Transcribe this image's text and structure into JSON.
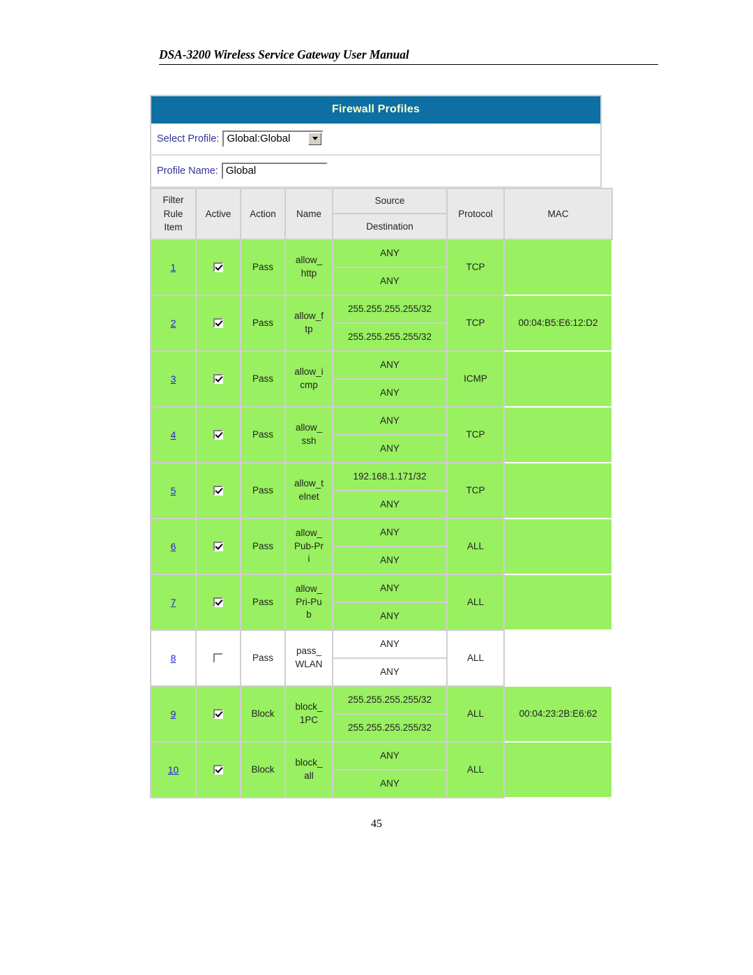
{
  "document": {
    "header_title": "DSA-3200 Wireless Service Gateway User Manual",
    "page_number": "45"
  },
  "panel": {
    "title": "Firewall Profiles",
    "select_profile": {
      "label": "Select Profile:",
      "value": "Global:Global",
      "options": [
        "Global:Global"
      ]
    },
    "profile_name": {
      "label": "Profile Name:",
      "value": "Global",
      "placeholder": ""
    }
  },
  "table": {
    "headers": {
      "item": "Filter Rule Item",
      "item_lines": [
        "Filter",
        "Rule",
        "Item"
      ],
      "active": "Active",
      "action": "Action",
      "name": "Name",
      "source": "Source",
      "destination": "Destination",
      "protocol": "Protocol",
      "mac": "MAC"
    },
    "rows": [
      {
        "item": "1",
        "active": true,
        "action": "Pass",
        "name_lines": [
          "allow_",
          "http"
        ],
        "source": "ANY",
        "destination": "ANY",
        "protocol": "TCP",
        "mac": "",
        "highlight": true
      },
      {
        "item": "2",
        "active": true,
        "action": "Pass",
        "name_lines": [
          "allow_f",
          "tp"
        ],
        "source": "255.255.255.255/32",
        "destination": "255.255.255.255/32",
        "protocol": "TCP",
        "mac": "00:04:B5:E6:12:D2",
        "highlight": true
      },
      {
        "item": "3",
        "active": true,
        "action": "Pass",
        "name_lines": [
          "allow_i",
          "cmp"
        ],
        "source": "ANY",
        "destination": "ANY",
        "protocol": "ICMP",
        "mac": "",
        "highlight": true
      },
      {
        "item": "4",
        "active": true,
        "action": "Pass",
        "name_lines": [
          "allow_",
          "ssh"
        ],
        "source": "ANY",
        "destination": "ANY",
        "protocol": "TCP",
        "mac": "",
        "highlight": true
      },
      {
        "item": "5",
        "active": true,
        "action": "Pass",
        "name_lines": [
          "allow_t",
          "elnet"
        ],
        "source": "192.168.1.171/32",
        "destination": "ANY",
        "protocol": "TCP",
        "mac": "",
        "highlight": true
      },
      {
        "item": "6",
        "active": true,
        "action": "Pass",
        "name_lines": [
          "allow_",
          "Pub-Pr",
          "i"
        ],
        "source": "ANY",
        "destination": "ANY",
        "protocol": "ALL",
        "mac": "",
        "highlight": true
      },
      {
        "item": "7",
        "active": true,
        "action": "Pass",
        "name_lines": [
          "allow_",
          "Pri-Pu",
          "b"
        ],
        "source": "ANY",
        "destination": "ANY",
        "protocol": "ALL",
        "mac": "",
        "highlight": true
      },
      {
        "item": "8",
        "active": false,
        "action": "Pass",
        "name_lines": [
          "pass_",
          "WLAN"
        ],
        "source": "ANY",
        "destination": "ANY",
        "protocol": "ALL",
        "mac": "",
        "highlight": false
      },
      {
        "item": "9",
        "active": true,
        "action": "Block",
        "name_lines": [
          "block_",
          "1PC"
        ],
        "source": "255.255.255.255/32",
        "destination": "255.255.255.255/32",
        "protocol": "ALL",
        "mac": "00:04:23:2B:E6:62",
        "highlight": true
      },
      {
        "item": "10",
        "active": true,
        "action": "Block",
        "name_lines": [
          "block_",
          "all"
        ],
        "source": "ANY",
        "destination": "ANY",
        "protocol": "ALL",
        "mac": "",
        "highlight": true
      }
    ]
  },
  "colors": {
    "titlebar_bg": "#0d6fa3",
    "titlebar_text": "#ffffcc",
    "row_highlight": "#99f060",
    "label_text": "#333399",
    "link": "#2222cc"
  }
}
